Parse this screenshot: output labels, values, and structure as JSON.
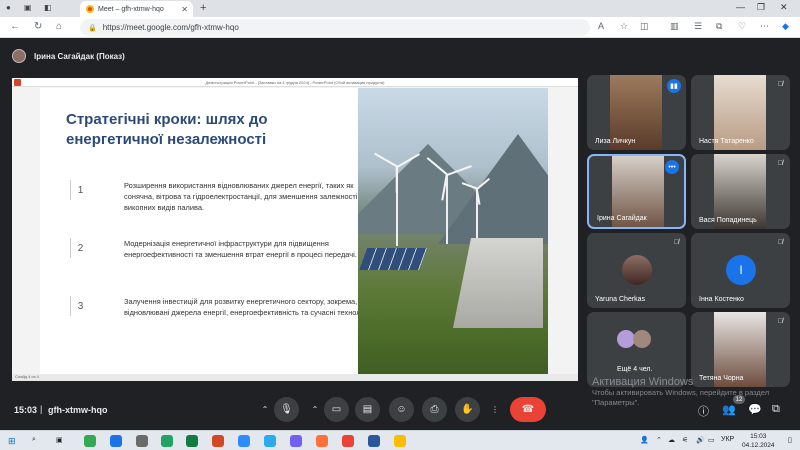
{
  "browser": {
    "tab_title": "Meet – gfh-xtmw-hqo",
    "url": "https://meet.google.com/gfh-xtmw-hqo"
  },
  "meet": {
    "presenter_label": "Ірина Сагайдак (Показ)",
    "clock": "15:03",
    "separator": "|",
    "meeting_code": "gfh-xtmw-hqo",
    "participants_count": "12"
  },
  "ppt": {
    "titlebar": "Демонстрация PowerPoint - [Заставки на 4 грудня 2024] - PowerPoint (Сбой активации продукта)",
    "status": "Слайд 4 из 4"
  },
  "slide": {
    "title": "Стратегічні кроки: шлях до енергетичної незалежності",
    "steps": [
      {
        "num": "1",
        "text": "Розширення використання відновлюваних джерел енергії, таких як сонячна, вітрова та гідроелектростанції, для зменшення залежності від викопних видів палива."
      },
      {
        "num": "2",
        "text": "Модернізація енергетичної інфраструктури для підвищення енергоефективності та зменшення втрат енергії в процесі передачі."
      },
      {
        "num": "3",
        "text": "Залучення інвестицій для розвитку енергетичного сектору, зокрема, у відновлювані джерела енергії, енергоефективність та сучасні технології."
      }
    ]
  },
  "participants": [
    {
      "name": "Лиза Личкун",
      "state": "speaking-indicator"
    },
    {
      "name": "Настя Татаренко",
      "state": "muted"
    },
    {
      "name": "Ірина Сагайдак",
      "state": "more"
    },
    {
      "name": "Вася Попадинець",
      "state": "muted"
    },
    {
      "name": "Yaruna Cherkas",
      "state": "muted"
    },
    {
      "name": "Інна Костенко",
      "state": "muted",
      "initial": "І"
    },
    {
      "name": "Ещё 4 чел.",
      "state": "group"
    },
    {
      "name": "Тетяна Чорна",
      "state": "muted"
    }
  ],
  "watermark": {
    "title": "Активация Windows",
    "subtitle": "Чтобы активировать Windows, перейдите в раздел \"Параметры\"."
  },
  "taskbar": {
    "lang": "УКР",
    "time": "15:03",
    "date": "04.12.2024"
  },
  "colors": {
    "meet_bg": "#202124",
    "end_call": "#ea4335",
    "slide_title": "#2b4a7b",
    "accent": "#8ab4f8"
  }
}
